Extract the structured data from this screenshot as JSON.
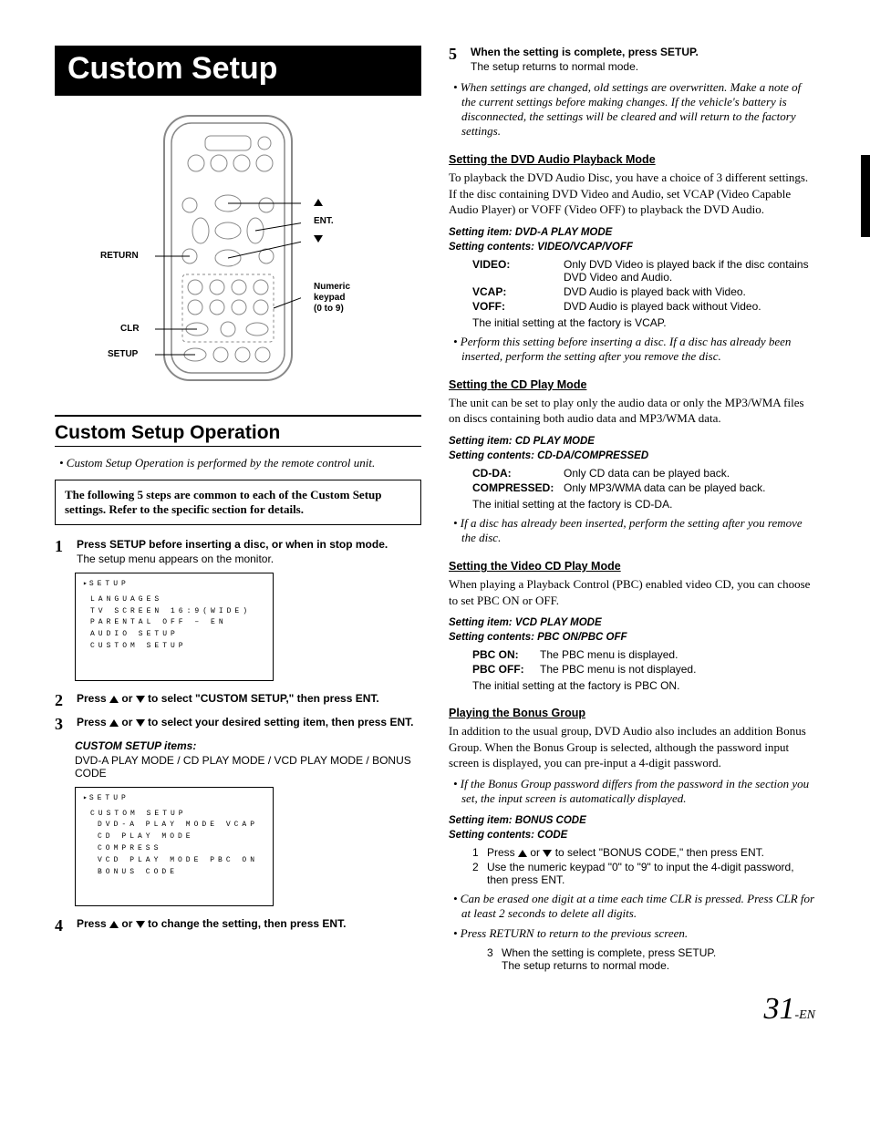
{
  "title": "Custom Setup",
  "remote": {
    "return": "RETURN",
    "clr": "CLR",
    "setup": "SETUP",
    "up": "▲",
    "ent": "ENT.",
    "down": "▼",
    "keypad1": "Numeric",
    "keypad2": "keypad",
    "keypad3": "(0 to 9)"
  },
  "section": "Custom Setup Operation",
  "intro_note": "• Custom Setup Operation is performed by the remote control unit.",
  "box_text": "The following 5 steps are common to each of the Custom Setup settings. Refer to the specific section for details.",
  "steps": {
    "s1": {
      "lead_a": "Press ",
      "lead_b": "SETUP",
      "lead_c": " before inserting a disc, or when in stop mode.",
      "sub": "The setup menu appears on the monitor."
    },
    "s2": {
      "lead_a": "Press ",
      "lead_mid": " or ",
      "lead_b": " to select \"CUSTOM SETUP,\" then press ",
      "lead_c": "ENT."
    },
    "s3": {
      "lead_a": "Press ",
      "lead_mid": " or ",
      "lead_b": " to select your desired setting item, then press ",
      "lead_c": "ENT."
    },
    "items_label": "CUSTOM SETUP items:",
    "items_body": "DVD-A PLAY MODE / CD PLAY MODE / VCD PLAY MODE / BONUS CODE",
    "s4": {
      "lead_a": "Press ",
      "lead_mid": " or ",
      "lead_b": " to change the setting, then press ",
      "lead_c": "ENT."
    },
    "s5": {
      "lead_a": "When the setting is complete, press ",
      "lead_b": "SETUP.",
      "sub": "The setup returns to normal mode."
    }
  },
  "screen1": {
    "title": "SETUP",
    "l1": "LANGUAGES",
    "l2": "TV SCREEN   16:9(WIDE)",
    "l3": "PARENTAL    OFF  – EN",
    "l4": "AUDIO SETUP",
    "l5": "CUSTOM SETUP"
  },
  "screen2": {
    "title": "SETUP",
    "h": "CUSTOM SETUP",
    "l1": "DVD-A PLAY MODE  VCAP",
    "l2": "CD PLAY MODE COMPRESS",
    "l3": "VCD PLAY MODE  PBC ON",
    "l4": "BONUS CODE"
  },
  "right": {
    "note_changed": "• When settings are changed, old settings are overwritten. Make a note of the current settings before making changes. If the vehicle's battery is disconnected, the settings will be cleared and will return to the factory settings.",
    "dvda": {
      "heading": "Setting the DVD Audio Playback Mode",
      "body": "To playback the DVD Audio Disc, you have a choice of 3 different settings. If the disc containing DVD Video and Audio, set VCAP (Video Capable Audio Player) or VOFF (Video OFF) to playback the DVD Audio.",
      "set_item": "Setting item: DVD-A PLAY MODE",
      "set_contents": "Setting contents: VIDEO/VCAP/VOFF",
      "video_t": "VIDEO:",
      "video_d": "Only DVD Video is played back if the disc contains DVD Video and Audio.",
      "vcap_t": "VCAP:",
      "vcap_d": "DVD Audio is played back with Video.",
      "voff_t": "VOFF:",
      "voff_d": "DVD Audio is played back without Video.",
      "initial": "The initial setting at the factory is VCAP.",
      "note": "• Perform this setting before inserting a disc. If a disc has already been inserted, perform the setting after you remove the disc."
    },
    "cd": {
      "heading": "Setting the CD Play Mode",
      "body": "The unit can be set to play only the audio data or only the MP3/WMA files on discs containing both audio data and MP3/WMA data.",
      "set_item": "Setting item: CD PLAY MODE",
      "set_contents": "Setting contents: CD-DA/COMPRESSED",
      "cdda_t": "CD-DA:",
      "cdda_d": "Only CD data can be played back.",
      "comp_t": "COMPRESSED:",
      "comp_d": "Only MP3/WMA data can be played back.",
      "initial": "The initial setting at the factory is CD-DA.",
      "note": "• If a disc has already been inserted, perform the setting after you remove the disc."
    },
    "vcd": {
      "heading": "Setting the Video CD Play Mode",
      "body": "When playing a Playback Control (PBC) enabled video CD, you can choose to set PBC ON or OFF.",
      "set_item": "Setting item: VCD PLAY MODE",
      "set_contents": "Setting contents: PBC ON/PBC OFF",
      "on_t": "PBC ON:",
      "on_d": "The PBC menu is displayed.",
      "off_t": "PBC OFF:",
      "off_d": "The PBC menu is not displayed.",
      "initial": "The initial setting at the factory is PBC ON."
    },
    "bonus": {
      "heading": "Playing the Bonus Group",
      "body": "In addition to the usual group, DVD Audio also includes an addition Bonus Group. When the Bonus Group is selected, although the password input screen is displayed, you can pre-input a 4-digit password.",
      "note1": "• If the Bonus Group password differs from the password in the section you set, the input screen is automatically displayed.",
      "set_item": "Setting item: BONUS CODE",
      "set_contents": "Setting contents: CODE",
      "n1a": "Press ",
      "n1mid": " or ",
      "n1b": " to select \"BONUS CODE,\" then press ENT.",
      "n2": "Use the numeric keypad \"0\" to \"9\" to input the 4-digit password, then press ENT.",
      "note2": "• Can be erased one digit at a time each time CLR is pressed. Press CLR for at least 2 seconds to delete all digits.",
      "note3": "• Press RETURN to return to the previous screen.",
      "n3a": "When the setting is complete, press SETUP.",
      "n3b": "The setup returns to normal mode."
    }
  },
  "page": {
    "num": "31",
    "suffix": "-EN"
  }
}
